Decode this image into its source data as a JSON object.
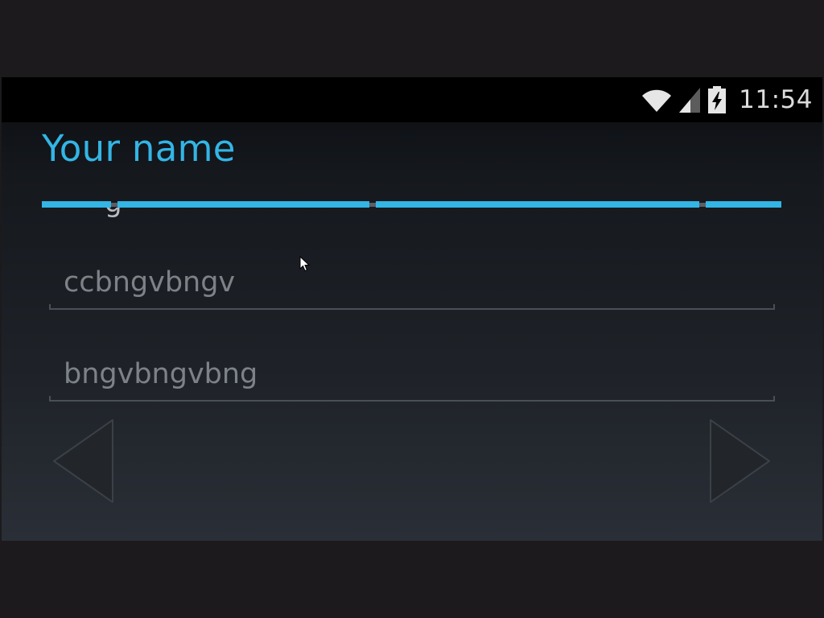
{
  "status_bar": {
    "time": "11:54",
    "icons": [
      "wifi-icon",
      "signal-icon",
      "battery-charging-icon"
    ]
  },
  "header": {
    "title": "Your name"
  },
  "form": {
    "first_name_value": "ccbngvbngv",
    "last_name_value": "bngvbngvbng"
  },
  "navigation": {
    "prev_icon": "triangle-left-icon",
    "next_icon": "triangle-right-icon"
  },
  "colors": {
    "accent": "#33b5e5",
    "status_bar": "#000000",
    "input_text": "#7d8288",
    "background": "#1c1a1d"
  }
}
